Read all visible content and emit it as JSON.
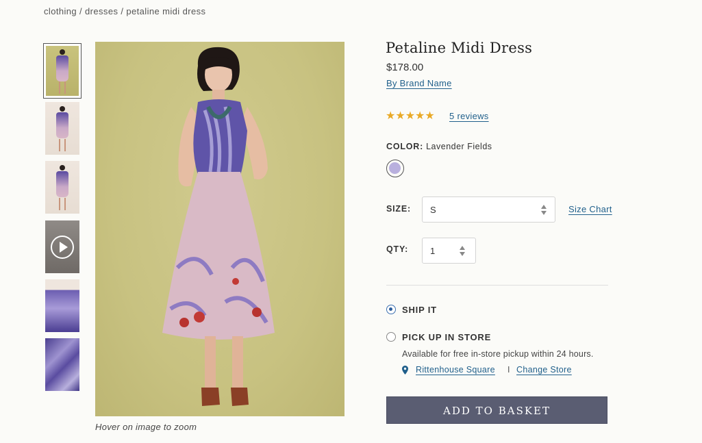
{
  "breadcrumb": "clothing / dresses / petaline midi dress",
  "gallery": {
    "thumbnails": [
      {
        "name": "thumb-1",
        "icon": "photo"
      },
      {
        "name": "thumb-2",
        "icon": "photo"
      },
      {
        "name": "thumb-3",
        "icon": "photo"
      },
      {
        "name": "thumb-video",
        "icon": "play-icon"
      },
      {
        "name": "thumb-5",
        "icon": "photo"
      },
      {
        "name": "thumb-6",
        "icon": "photo"
      }
    ],
    "zoom_hint": "Hover on image to zoom"
  },
  "product": {
    "title": "Petaline Midi Dress",
    "price": "$178.00",
    "brand_link": "By Brand Name",
    "rating_stars": "★★★★★",
    "reviews_link": "5 reviews",
    "color_label": "COLOR:",
    "color_value": "Lavender Fields",
    "swatch_color": "#b9b0de",
    "size_label": "SIZE:",
    "size_value": "S",
    "size_chart_link": "Size Chart",
    "qty_label": "QTY:",
    "qty_value": "1"
  },
  "fulfillment": {
    "ship_label": "SHIP IT",
    "pickup_label": "PICK UP IN STORE",
    "pickup_note": "Available for free in-store pickup within 24 hours.",
    "store_name": "Rittenhouse Square",
    "separator": "I",
    "change_store": "Change Store"
  },
  "cta": {
    "add_to_basket": "ADD TO BASKET"
  },
  "colors": {
    "link": "#1f5f8b",
    "star": "#e9a926",
    "button_bg": "#5a5d72",
    "radio_on": "#2b5d9c"
  }
}
